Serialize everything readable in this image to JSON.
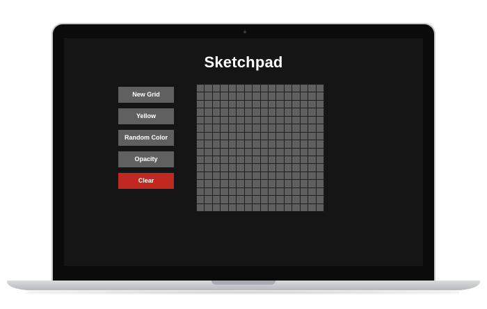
{
  "app": {
    "title": "Sketchpad"
  },
  "controls": {
    "new_grid": "New Grid",
    "yellow": "Yellow",
    "random_color": "Random Color",
    "opacity": "Opacity",
    "clear": "Clear"
  },
  "grid": {
    "size": 16,
    "cell_color": "#5f5f5f"
  },
  "colors": {
    "button": "#606060",
    "clear_button": "#c0291f",
    "screen_background": "#151515"
  }
}
